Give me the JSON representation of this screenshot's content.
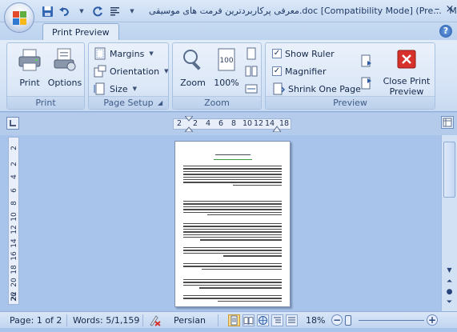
{
  "window": {
    "title": "معرفی پرکاربردترین فرمت های موسیقی.doc [Compatibility Mode] (Pre...",
    "title_tail": "M",
    "controls": {
      "minimize": "–",
      "close": "×"
    }
  },
  "tabs": [
    {
      "label": "Print Preview",
      "active": true
    }
  ],
  "help_label": "?",
  "ribbon": {
    "groups": {
      "print": {
        "label": "Print",
        "buttons": {
          "print": "Print",
          "options": "Options"
        }
      },
      "page_setup": {
        "label": "Page Setup",
        "margins": "Margins",
        "orientation": "Orientation",
        "size": "Size"
      },
      "zoom": {
        "label": "Zoom",
        "zoom": "Zoom",
        "zoom100": "100%"
      },
      "preview": {
        "label": "Preview",
        "show_ruler": {
          "label": "Show Ruler",
          "checked": true
        },
        "magnifier": {
          "label": "Magnifier",
          "checked": true
        },
        "shrink_one_page": "Shrink One Page",
        "close_preview_line1": "Close Print",
        "close_preview_line2": "Preview"
      }
    }
  },
  "rulers": {
    "horizontal_ticks": [
      "2",
      "2",
      "4",
      "6",
      "8",
      "10",
      "12",
      "14",
      "18"
    ],
    "vertical_ticks": [
      "2",
      "2",
      "4",
      "6",
      "8",
      "10",
      "12",
      "14",
      "16",
      "18",
      "20",
      "22",
      "26"
    ]
  },
  "status": {
    "page": "Page: 1 of 2",
    "words": "Words: 5/1,159",
    "language": "Persian",
    "zoom": "18%"
  },
  "colors": {
    "accent": "#2557a8",
    "close_red": "#d8302a",
    "ribbon_bg": "#d6e4f6"
  }
}
